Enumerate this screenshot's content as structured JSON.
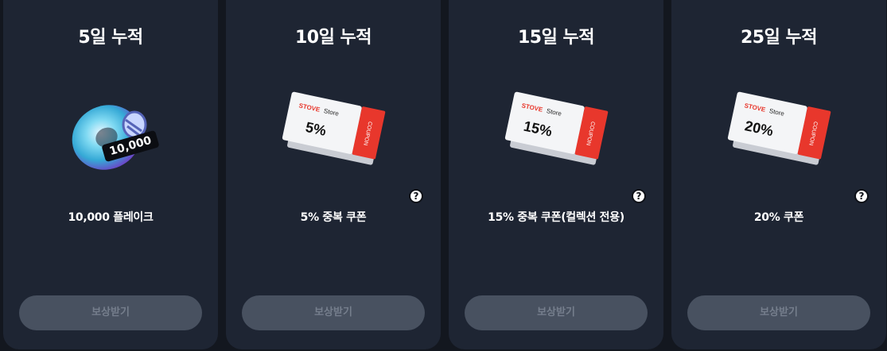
{
  "cards": [
    {
      "title": "5일 누적",
      "reward": "10,000 플레이크",
      "badge": "10,000",
      "has_help": false,
      "claim_label": "보상받기"
    },
    {
      "title": "10일 누적",
      "reward": "5% 중복 쿠폰",
      "percent": "5%",
      "has_help": true,
      "claim_label": "보상받기"
    },
    {
      "title": "15일 누적",
      "reward": "15% 중복 쿠폰(컬렉션 전용)",
      "percent": "15%",
      "has_help": true,
      "claim_label": "보상받기"
    },
    {
      "title": "25일 누적",
      "reward": "20% 쿠폰",
      "percent": "20%",
      "has_help": true,
      "claim_label": "보상받기"
    }
  ],
  "coupon": {
    "brand": "STOVE",
    "store": "Store",
    "tab": "COUPON"
  },
  "help_glyph": "?",
  "colors": {
    "card_bg": "#1e2533",
    "page_bg": "#13171f",
    "button_bg": "#485160",
    "button_text": "#757e8c",
    "coupon_red": "#e8372c"
  }
}
